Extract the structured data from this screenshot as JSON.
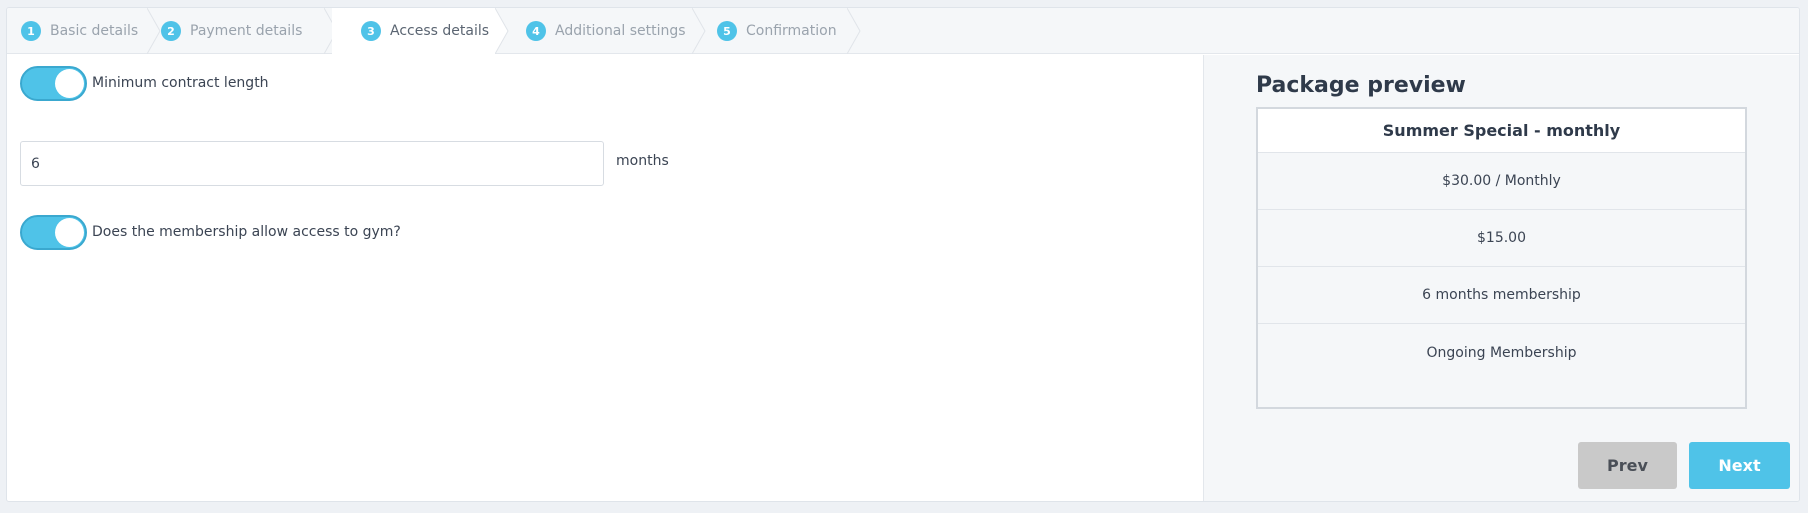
{
  "wizard": {
    "steps": [
      {
        "num": "1",
        "label": "Basic details"
      },
      {
        "num": "2",
        "label": "Payment details"
      },
      {
        "num": "3",
        "label": "Access details"
      },
      {
        "num": "4",
        "label": "Additional settings"
      },
      {
        "num": "5",
        "label": "Confirmation"
      }
    ],
    "active_step": "3"
  },
  "form": {
    "min_contract": {
      "label": "Minimum contract length",
      "enabled": true
    },
    "contract_length": {
      "value": "6",
      "unit": "months"
    },
    "gym_access": {
      "label": "Does the membership allow access to gym?",
      "enabled": true
    }
  },
  "preview": {
    "title": "Package preview",
    "package_name": "Summer Special - monthly",
    "rows": [
      "$30.00 / Monthly",
      "$15.00",
      "6 months membership",
      "Ongoing Membership"
    ]
  },
  "buttons": {
    "prev": "Prev",
    "next": "Next"
  },
  "colors": {
    "accent": "#4fc3e8",
    "prev_button": "#c9c9c9"
  }
}
